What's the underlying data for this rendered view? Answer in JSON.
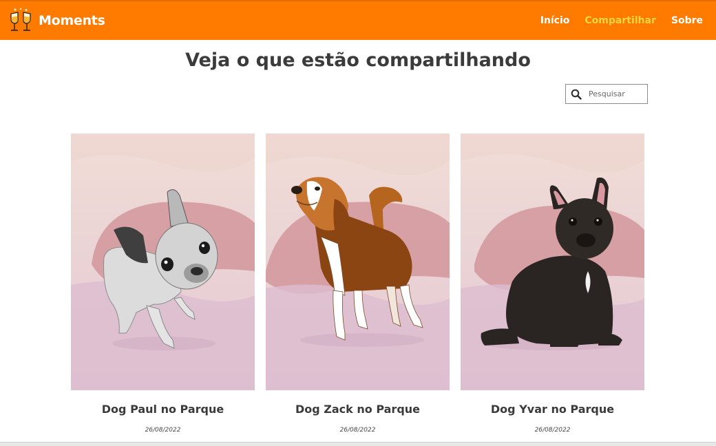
{
  "header": {
    "brand": "Moments",
    "nav": [
      {
        "label": "Início",
        "active": false
      },
      {
        "label": "Compartilhar",
        "active": true
      },
      {
        "label": "Sobre",
        "active": false
      }
    ],
    "colors": {
      "bar": "#ff7b00",
      "active_link": "#f2d443"
    }
  },
  "main": {
    "title": "Veja o que estão compartilhando",
    "search": {
      "placeholder": "Pesquisar",
      "icon": "search-icon"
    },
    "moments": [
      {
        "title": "Dog Paul no Parque",
        "date": "26/08/2022",
        "image": "grey-french-bulldog"
      },
      {
        "title": "Dog Zack no Parque",
        "date": "26/08/2022",
        "image": "beagle"
      },
      {
        "title": "Dog Yvar no Parque",
        "date": "26/08/2022",
        "image": "brindle-french-bulldog"
      }
    ]
  }
}
